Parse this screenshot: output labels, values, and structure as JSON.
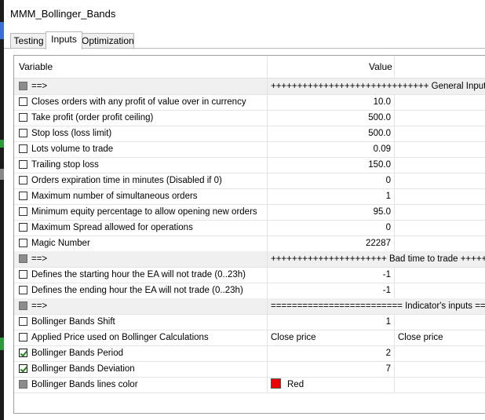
{
  "window": {
    "title": "MMM_Bollinger_Bands"
  },
  "tabs": [
    {
      "label": "Testing",
      "active": false
    },
    {
      "label": "Inputs",
      "active": true
    },
    {
      "label": "Optimization",
      "active": false
    }
  ],
  "grid": {
    "columns": {
      "variable": "Variable",
      "value": "Value"
    },
    "rows": [
      {
        "type": "separator",
        "name": "==>",
        "value": "++++++++++++++++++++++++++++++ General Inputs ++++++++++++++++++++++"
      },
      {
        "type": "param",
        "checked": false,
        "name": "Closes orders with any profit of value over in currency",
        "value": "10.0"
      },
      {
        "type": "param",
        "checked": false,
        "name": "Take profit (order profit ceiling)",
        "value": "500.0"
      },
      {
        "type": "param",
        "checked": false,
        "name": "Stop loss (loss limit)",
        "value": "500.0"
      },
      {
        "type": "param",
        "checked": false,
        "name": "Lots volume to trade",
        "value": "0.09"
      },
      {
        "type": "param",
        "checked": false,
        "name": "Trailing stop loss",
        "value": "150.0"
      },
      {
        "type": "param",
        "checked": false,
        "name": "Orders expiration time in minutes (Disabled if 0)",
        "value": "0"
      },
      {
        "type": "param",
        "checked": false,
        "name": "Maximum number of simultaneous orders",
        "value": "1"
      },
      {
        "type": "param",
        "checked": false,
        "name": "Minimum equity percentage to allow opening new orders",
        "value": "95.0"
      },
      {
        "type": "param",
        "checked": false,
        "name": "Maximum Spread allowed for operations",
        "value": "0"
      },
      {
        "type": "param",
        "checked": false,
        "name": "Magic Number",
        "value": "22287"
      },
      {
        "type": "separator",
        "name": "==>",
        "value": "++++++++++++++++++++++ Bad time to trade +++++++++++++++++++++++++"
      },
      {
        "type": "param",
        "checked": false,
        "name": "Defines the starting hour the EA will not trade (0..23h)",
        "value": "-1"
      },
      {
        "type": "param",
        "checked": false,
        "name": "Defines the ending hour the EA will not trade (0..23h)",
        "value": "-1"
      },
      {
        "type": "separator",
        "name": "==>",
        "value": "========================= Indicator's inputs =============================="
      },
      {
        "type": "param",
        "checked": false,
        "name": "Bollinger Bands Shift",
        "value": "1"
      },
      {
        "type": "param",
        "checked": false,
        "name": "Applied Price used on Bollinger Calculations",
        "value": "Close price",
        "value2": "Close price"
      },
      {
        "type": "param",
        "checked": true,
        "name": "Bollinger Bands Period",
        "value": "2"
      },
      {
        "type": "param",
        "checked": true,
        "name": "Bollinger Bands Deviation",
        "value": "7"
      },
      {
        "type": "color",
        "checked": false,
        "name": "Bollinger Bands lines color",
        "value": "Red",
        "color": "#ee0000"
      }
    ]
  }
}
